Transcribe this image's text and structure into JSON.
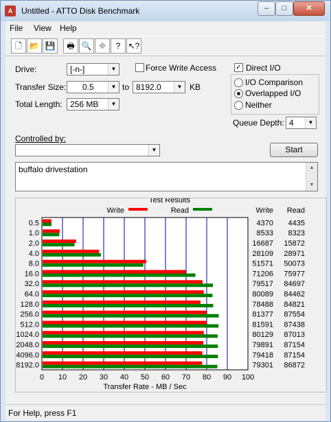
{
  "window": {
    "title": "Untitled - ATTO Disk Benchmark",
    "app_icon": "atto-app-icon"
  },
  "caption_buttons": {
    "minimize": "–",
    "maximize": "□",
    "close": "✕"
  },
  "menu": [
    {
      "label": "File"
    },
    {
      "label": "View"
    },
    {
      "label": "Help"
    }
  ],
  "toolbar": [
    "new-icon",
    "open-icon",
    "save-icon",
    "print-icon",
    "print-preview-icon",
    "move-icon",
    "help-icon",
    "context-help-icon"
  ],
  "form": {
    "drive_label": "Drive:",
    "drive_value": "[-n-]",
    "force_write_label": "Force Write Access",
    "force_write_checked": false,
    "direct_io_label": "Direct I/O",
    "direct_io_checked": true,
    "transfer_size_label": "Transfer Size:",
    "transfer_from": "0.5",
    "to_label": "to",
    "transfer_to": "8192.0",
    "kb_label": "KB",
    "total_length_label": "Total Length:",
    "total_length_value": "256 MB",
    "io_options": [
      {
        "label": "I/O Comparison",
        "selected": false
      },
      {
        "label": "Overlapped I/O",
        "selected": true
      },
      {
        "label": "Neither",
        "selected": false
      }
    ],
    "queue_depth_label": "Queue Depth:",
    "queue_depth_value": "4",
    "controlled_by_label": "Controlled by:",
    "controlled_by_value": "",
    "start_label": "Start",
    "description": "buffalo drivestation"
  },
  "results": {
    "group_title": "Test Results",
    "legend_write": "Write",
    "legend_read": "Read",
    "col_write": "Write",
    "col_read": "Read",
    "x_label": "Transfer Rate - MB / Sec",
    "write_color": "#ff0000",
    "read_color": "#008000"
  },
  "chart_data": {
    "type": "bar",
    "categories": [
      "0.5",
      "1.0",
      "2.0",
      "4.0",
      "8.0",
      "16.0",
      "32.0",
      "64.0",
      "128.0",
      "256.0",
      "512.0",
      "1024.0",
      "2048.0",
      "4096.0",
      "8192.0"
    ],
    "series": [
      {
        "name": "Write",
        "values": [
          4370,
          8533,
          16687,
          28109,
          51571,
          71206,
          79517,
          80089,
          78488,
          81377,
          81591,
          80129,
          79891,
          79418,
          79301
        ]
      },
      {
        "name": "Read",
        "values": [
          4435,
          8323,
          15872,
          28971,
          50073,
          75977,
          84697,
          84462,
          84821,
          87554,
          87438,
          87013,
          87154,
          87154,
          86872
        ]
      }
    ],
    "xlabel": "Transfer Rate - MB / Sec",
    "xticks": [
      "0",
      "10",
      "20",
      "30",
      "40",
      "50",
      "60",
      "70",
      "80",
      "90",
      "100"
    ],
    "xlim": [
      0,
      100
    ],
    "value_units": "KB/s"
  },
  "status": {
    "text": "For Help, press F1"
  }
}
